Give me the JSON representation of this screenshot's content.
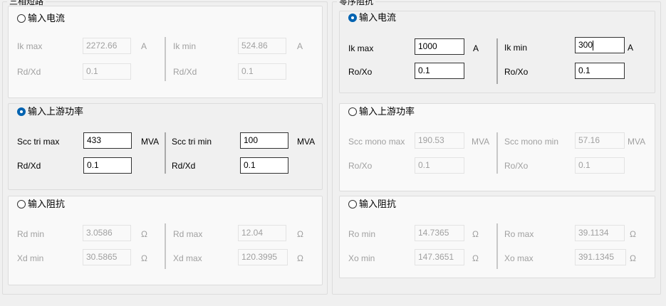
{
  "left_group": {
    "title": "三相短路",
    "current": {
      "radio_label": "输入电流",
      "checked": false,
      "ik_max_label": "Ik max",
      "ik_max_value": "2272.66",
      "ik_max_unit": "A",
      "ik_min_label": "Ik min",
      "ik_min_value": "524.86",
      "ik_min_unit": "A",
      "r1_label": "Rd/Xd",
      "r1_value": "0.1",
      "r2_label": "Rd/Xd",
      "r2_value": "0.1"
    },
    "power": {
      "radio_label": "输入上游功率",
      "checked": true,
      "scc_max_label": "Scc tri max",
      "scc_max_value": "433",
      "scc_max_unit": "MVA",
      "scc_min_label": "Scc tri min",
      "scc_min_value": "100",
      "scc_min_unit": "MVA",
      "r1_label": "Rd/Xd",
      "r1_value": "0.1",
      "r2_label": "Rd/Xd",
      "r2_value": "0.1"
    },
    "impedance": {
      "radio_label": "输入阻抗",
      "checked": false,
      "a1_label": "Rd min",
      "a1_value": "3.0586",
      "a1_unit": "Ω",
      "a2_label": "Rd max",
      "a2_value": "12.04",
      "a2_unit": "Ω",
      "b1_label": "Xd min",
      "b1_value": "30.5865",
      "b1_unit": "Ω",
      "b2_label": "Xd max",
      "b2_value": "120.3995",
      "b2_unit": "Ω"
    }
  },
  "right_group": {
    "title": "零序阻抗",
    "current": {
      "radio_label": "输入电流",
      "checked": true,
      "ik_max_label": "Ik max",
      "ik_max_value": "1000",
      "ik_max_unit": "A",
      "ik_min_label": "Ik min",
      "ik_min_value": "300",
      "ik_min_unit": "A",
      "r1_label": "Ro/Xo",
      "r1_value": "0.1",
      "r2_label": "Ro/Xo",
      "r2_value": "0.1"
    },
    "power": {
      "radio_label": "输入上游功率",
      "checked": false,
      "scc_max_label": "Scc mono max",
      "scc_max_value": "190.53",
      "scc_max_unit": "MVA",
      "scc_min_label": "Scc mono min",
      "scc_min_value": "57.16",
      "scc_min_unit": "MVA",
      "r1_label": "Ro/Xo",
      "r1_value": "0.1",
      "r2_label": "Ro/Xo",
      "r2_value": "0.1"
    },
    "impedance": {
      "radio_label": "输入阻抗",
      "checked": false,
      "a1_label": "Ro min",
      "a1_value": "14.7365",
      "a1_unit": "Ω",
      "a2_label": "Ro max",
      "a2_value": "39.1134",
      "a2_unit": "Ω",
      "b1_label": "Xo min",
      "b1_value": "147.3651",
      "b1_unit": "Ω",
      "b2_label": "Xo max",
      "b2_value": "391.1345",
      "b2_unit": "Ω"
    }
  },
  "colors": {
    "accent": "#0063b1",
    "disabled_text": "#a0a0a0",
    "border": "#dcdcdc"
  }
}
